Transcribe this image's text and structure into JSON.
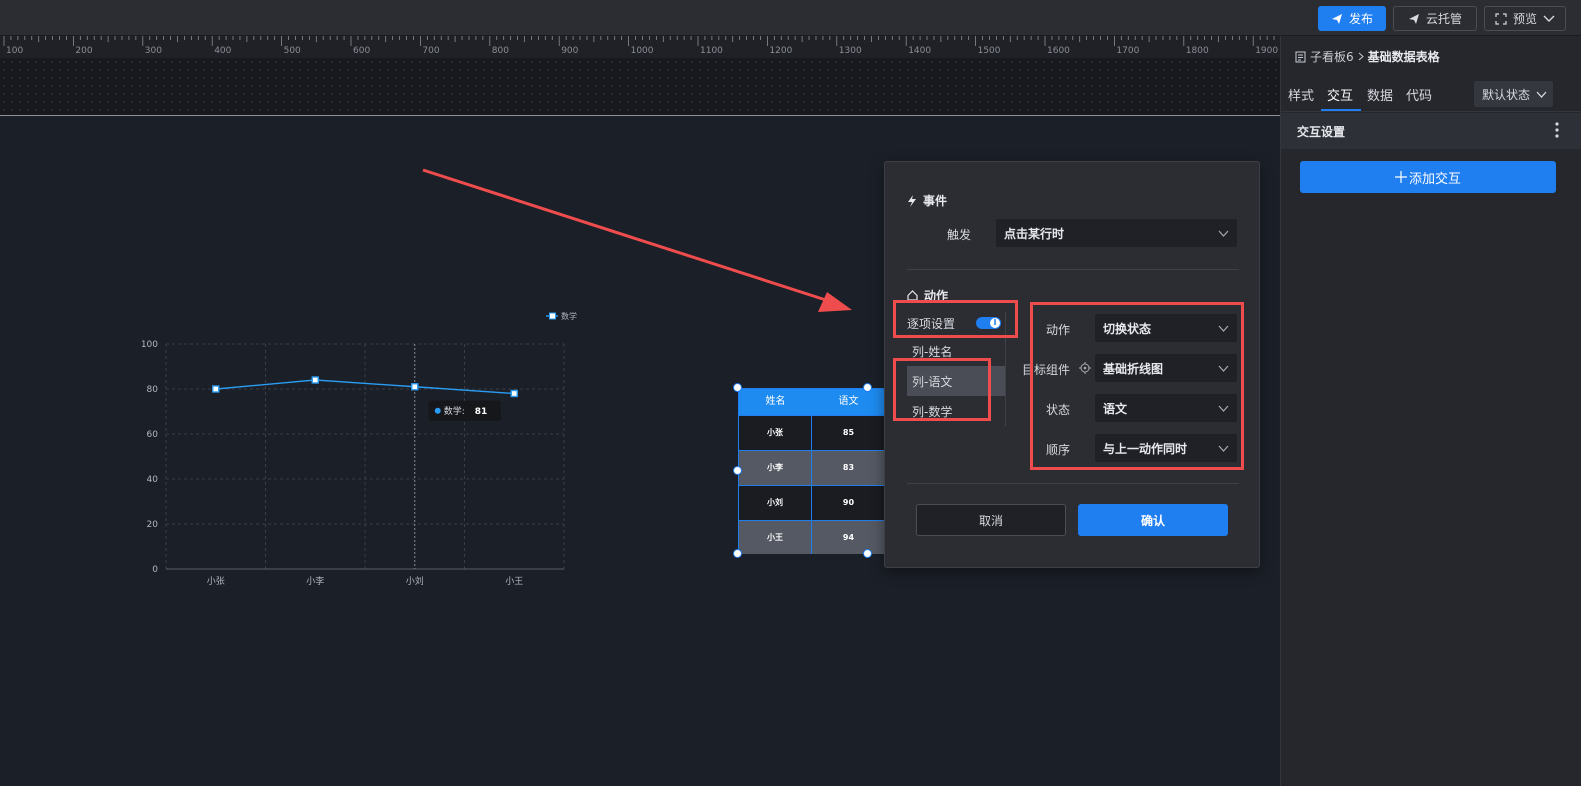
{
  "topbar": {
    "publish_label": "发布",
    "cloud_label": "云托管",
    "preview_label": "预览",
    "colors": {
      "primary": "#1f7ef0"
    }
  },
  "ruler": {
    "ticks": [
      "100",
      "200",
      "300",
      "400",
      "500",
      "600",
      "700",
      "800",
      "900",
      "1000",
      "1100",
      "1200",
      "1300",
      "1400",
      "1500",
      "1600",
      "1700",
      "1800",
      "1900"
    ]
  },
  "right_panel": {
    "breadcrumb_parent": "子看板6",
    "breadcrumb_current": "基础数据表格",
    "tabs": [
      {
        "label": "样式"
      },
      {
        "label": "交互"
      },
      {
        "label": "数据"
      },
      {
        "label": "代码"
      }
    ],
    "active_tab": "交互",
    "state_select": "默认状态",
    "section_title": "交互设置",
    "add_button": "添加交互"
  },
  "chart_data": {
    "type": "line",
    "categories": [
      "小张",
      "小李",
      "小刘",
      "小王"
    ],
    "series": [
      {
        "name": "数学",
        "values": [
          80,
          84,
          81,
          78
        ]
      }
    ],
    "ylim": [
      0,
      100
    ],
    "yticks": [
      0,
      20,
      40,
      60,
      80,
      100
    ],
    "grid": true,
    "legend": "top-right",
    "tooltip": {
      "label": "数学:",
      "value": "81"
    },
    "color": "#2a9cf2"
  },
  "table_widget": {
    "columns": [
      "姓名",
      "语文"
    ],
    "rows": [
      [
        "小张",
        "85"
      ],
      [
        "小李",
        "83"
      ],
      [
        "小刘",
        "90"
      ],
      [
        "小王",
        "94"
      ]
    ]
  },
  "dialog": {
    "event_title": "事件",
    "trigger_label": "触发",
    "trigger_value": "点击某行时",
    "action_title": "动作",
    "item_setting_label": "逐项设置",
    "toggle_mark": "I",
    "columns": [
      "列-姓名",
      "列-语文",
      "列-数学"
    ],
    "active_column": "列-语文",
    "fields": [
      {
        "label": "动作",
        "value": "切换状态"
      },
      {
        "label": "目标组件",
        "value": "基础折线图"
      },
      {
        "label": "状态",
        "value": "语文"
      },
      {
        "label": "顺序",
        "value": "与上一动作同时"
      }
    ],
    "cancel_label": "取消",
    "confirm_label": "确认"
  }
}
